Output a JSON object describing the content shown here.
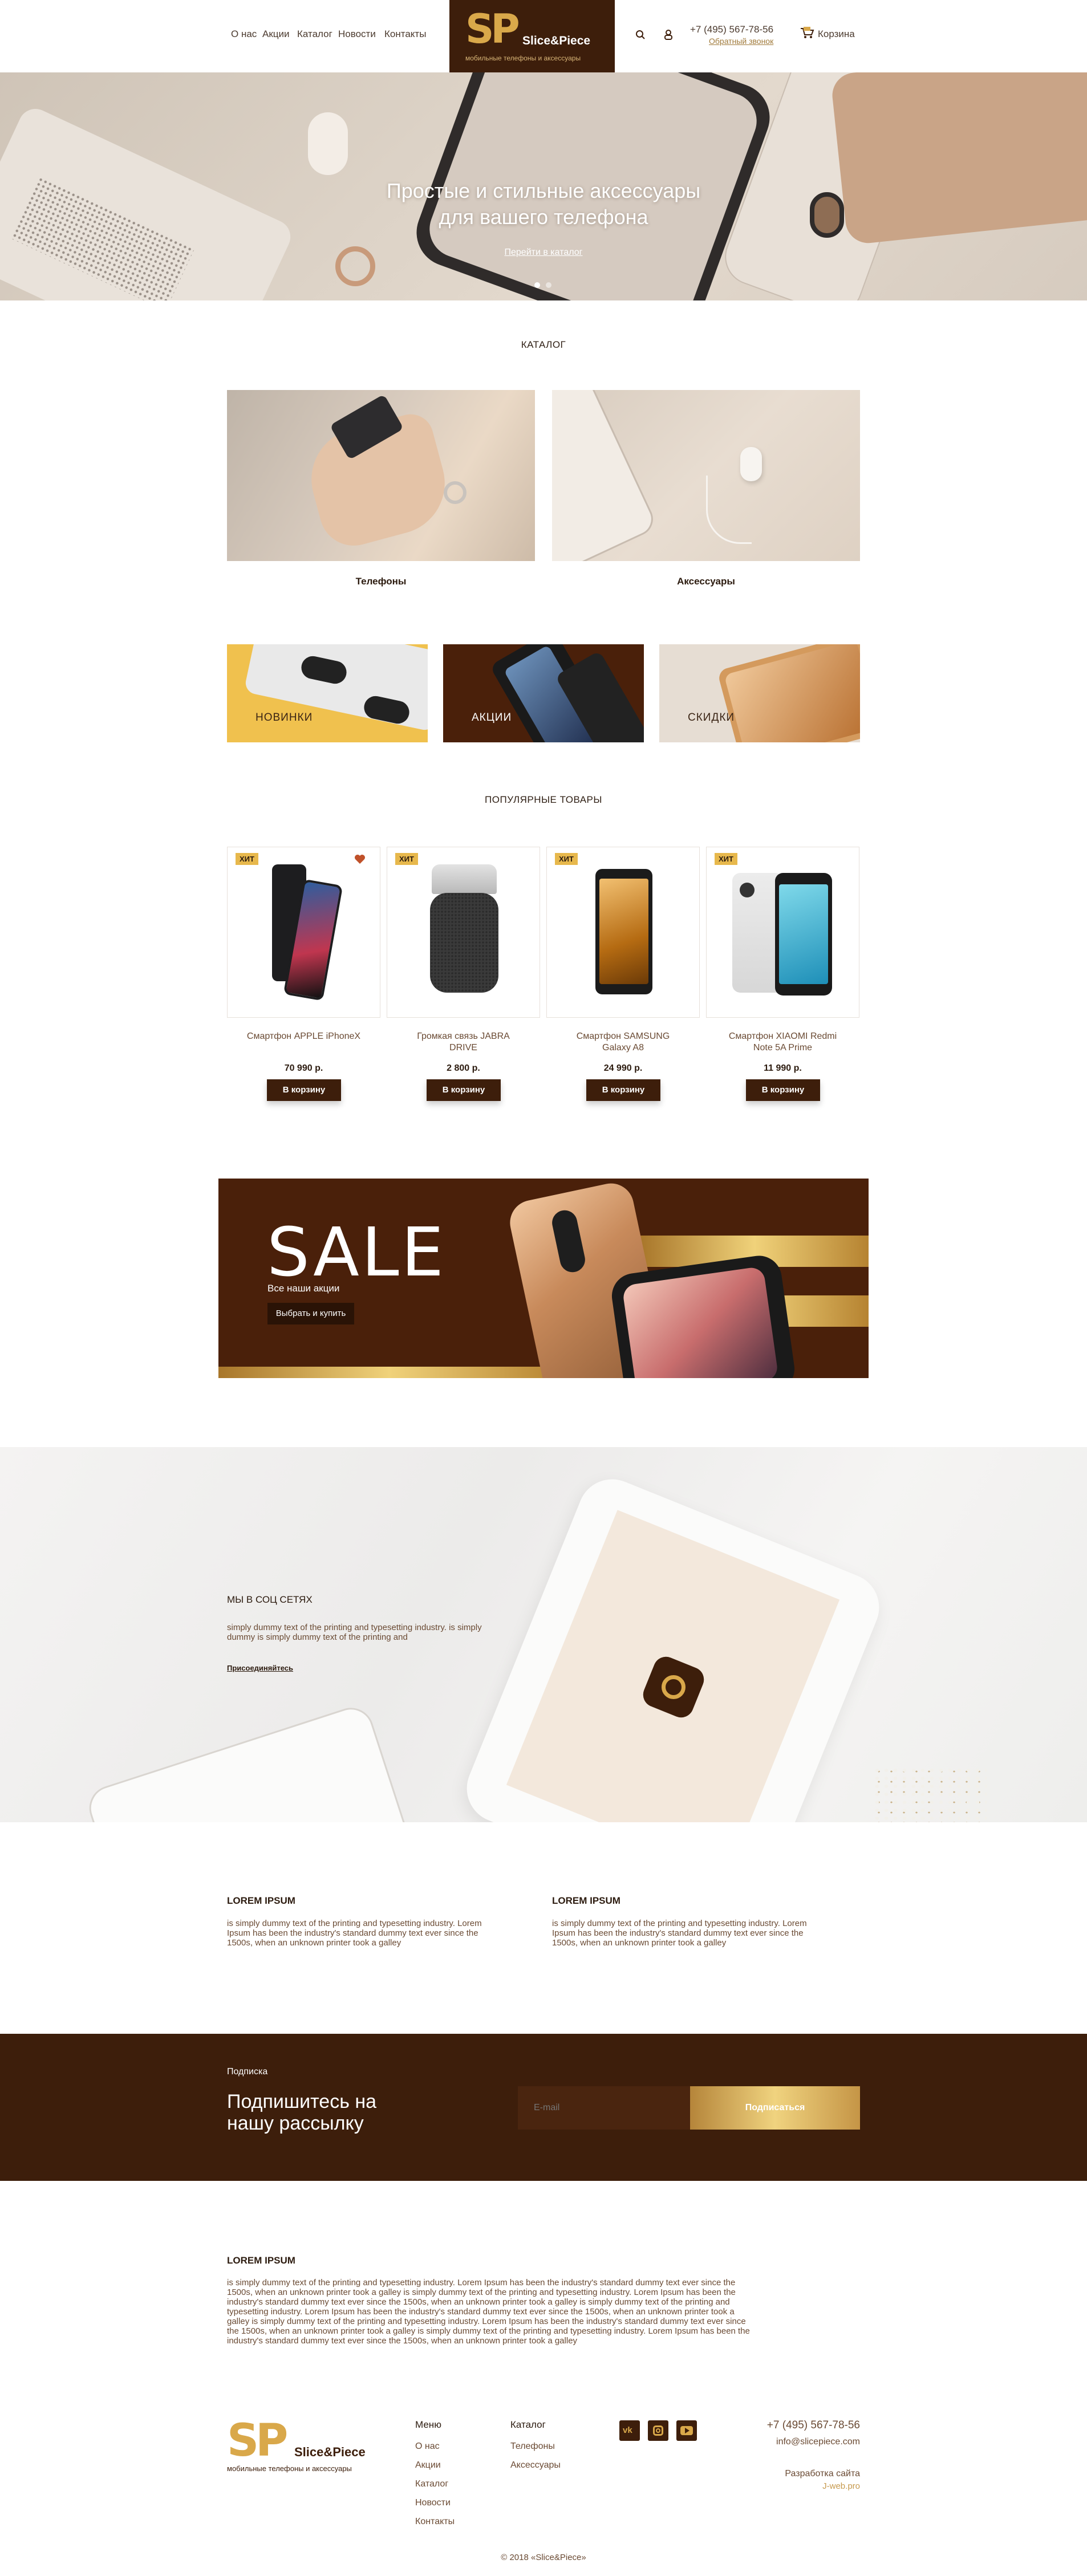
{
  "header": {
    "nav": [
      "О нас",
      "Акции",
      "Каталог",
      "Новости",
      "Контакты"
    ],
    "logo": {
      "mark": "SP",
      "name": "Slice&Piece",
      "tagline": "мобильные телефоны и аксессуары"
    },
    "phone": "+7 (495) 567-78-56",
    "callback": "Обратный звонок",
    "cart": "Корзина"
  },
  "hero": {
    "title_line1": "Простые и стильные аксессуары",
    "title_line2": "для вашего телефона",
    "link": "Перейти в каталог"
  },
  "catalog": {
    "title": "КАТАЛОГ",
    "categories": [
      "Телефоны",
      "Аксессуары"
    ],
    "promos": [
      "НОВИНКИ",
      "АКЦИИ",
      "СКИДКИ"
    ]
  },
  "popular": {
    "title": "ПОПУЛЯРНЫЕ ТОВАРЫ",
    "badge": "ХИТ",
    "buy_label": "В корзину",
    "products": [
      {
        "name_line1": "Смартфон APPLE iPhoneX",
        "name_line2": "",
        "price": "70 990 р."
      },
      {
        "name_line1": "Громкая связь JABRA",
        "name_line2": "DRIVE",
        "price": "2 800 р."
      },
      {
        "name_line1": "Смартфон SAMSUNG",
        "name_line2": "Galaxy A8",
        "price": "24 990 р."
      },
      {
        "name_line1": "Смартфон XIAOMI Redmi",
        "name_line2": "Note 5A Prime",
        "price": "11 990 р."
      }
    ]
  },
  "sale": {
    "title": "SALE",
    "subtitle": "Все наши акции",
    "button": "Выбрать и купить"
  },
  "social": {
    "title": "МЫ В СОЦ СЕТЯХ",
    "text_line1": "simply dummy text of the printing and typesetting industry. is simply",
    "text_line2": "dummy is simply dummy text of the printing and",
    "link": "Присоединяйтесь"
  },
  "info": [
    {
      "title": "LOREM IPSUM",
      "lines": [
        "is simply dummy text of the printing and typesetting industry. Lorem",
        "Ipsum has been the industry's standard dummy text ever since the",
        "1500s, when an unknown printer took a galley"
      ]
    },
    {
      "title": "LOREM IPSUM",
      "lines": [
        "is simply dummy text of the printing and typesetting industry. Lorem",
        "Ipsum has been the industry's standard dummy text ever since the",
        "1500s, when an unknown printer took a galley"
      ]
    }
  ],
  "subscribe": {
    "label": "Подписка",
    "title_line1": "Подпишитесь на",
    "title_line2": "нашу рассылку",
    "placeholder": "E-mail",
    "button": "Подписаться"
  },
  "about": {
    "title": "LOREM IPSUM",
    "lines": [
      "is simply dummy text of the printing and typesetting industry. Lorem Ipsum has been the industry's standard dummy text ever since the",
      "1500s, when an unknown printer took a galley is simply dummy text of the printing and typesetting industry. Lorem Ipsum has been the",
      "industry's standard dummy text ever since the 1500s, when an unknown printer took a galley is simply dummy text of the printing and",
      "typesetting industry. Lorem Ipsum has been the industry's standard dummy text ever since the 1500s, when an unknown printer took a",
      "galley is simply dummy text of the printing and typesetting industry. Lorem Ipsum has been the industry's standard dummy text ever since",
      "the 1500s, when an unknown printer took a galley is simply dummy text of the printing and typesetting industry. Lorem Ipsum has been the",
      "industry's standard dummy text ever since the 1500s, when an unknown printer took a galley"
    ]
  },
  "footer": {
    "menu_title": "Меню",
    "menu": [
      "О нас",
      "Акции",
      "Каталог",
      "Новости",
      "Контакты"
    ],
    "catalog_title": "Каталог",
    "catalog": [
      "Телефоны",
      "Аксессуары"
    ],
    "phone": "+7 (495) 567-78-56",
    "email": "info@slicepiece.com",
    "dev_label": "Разработка сайта",
    "dev_link": "J-web.pro",
    "copyright": "© 2018 «Slice&Piece»",
    "social_icons": [
      "vk-icon",
      "instagram-icon",
      "youtube-icon"
    ]
  },
  "colors": {
    "brown": "#3d1e0b",
    "gold": "#d9a84a",
    "text": "#6a4a33"
  }
}
